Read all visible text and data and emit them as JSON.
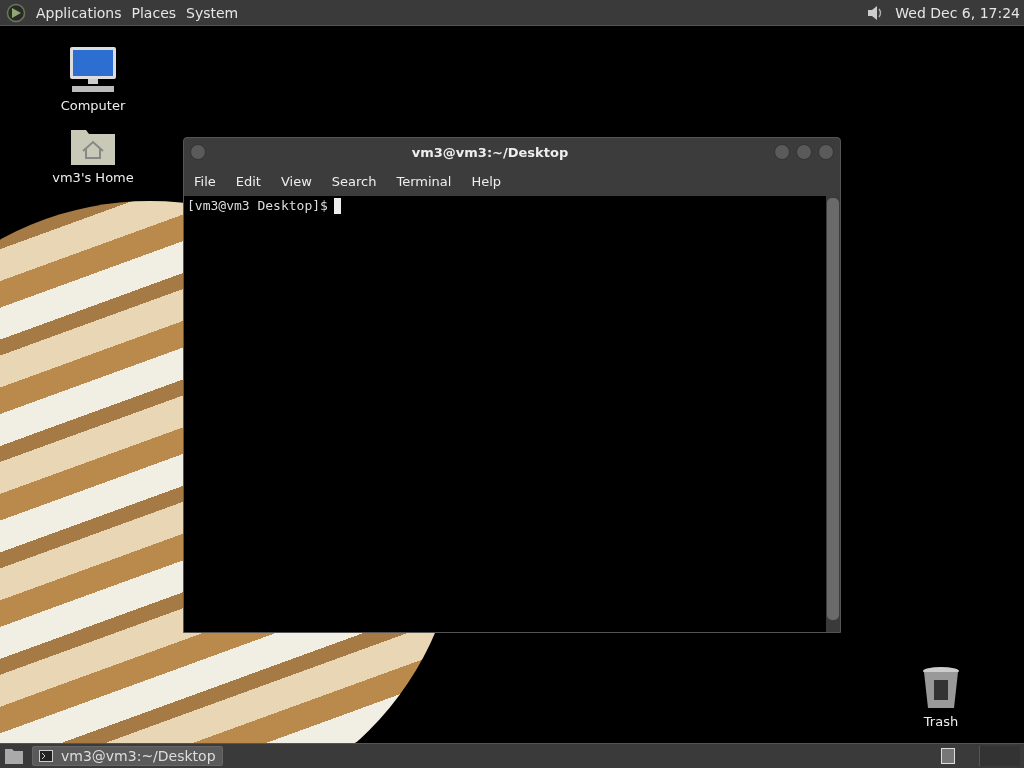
{
  "top_panel": {
    "menus": [
      "Applications",
      "Places",
      "System"
    ],
    "clock": "Wed Dec  6, 17:24"
  },
  "desktop_icons": [
    {
      "label": "Computer",
      "kind": "computer"
    },
    {
      "label": "vm3's Home",
      "kind": "home"
    },
    {
      "label": "Trash",
      "kind": "trash"
    }
  ],
  "terminal": {
    "title": "vm3@vm3:~/Desktop",
    "menu": [
      "File",
      "Edit",
      "View",
      "Search",
      "Terminal",
      "Help"
    ],
    "prompt": "[vm3@vm3 Desktop]$"
  },
  "taskbar": {
    "tasks": [
      {
        "label": "vm3@vm3:~/Desktop",
        "selected": true
      }
    ]
  }
}
